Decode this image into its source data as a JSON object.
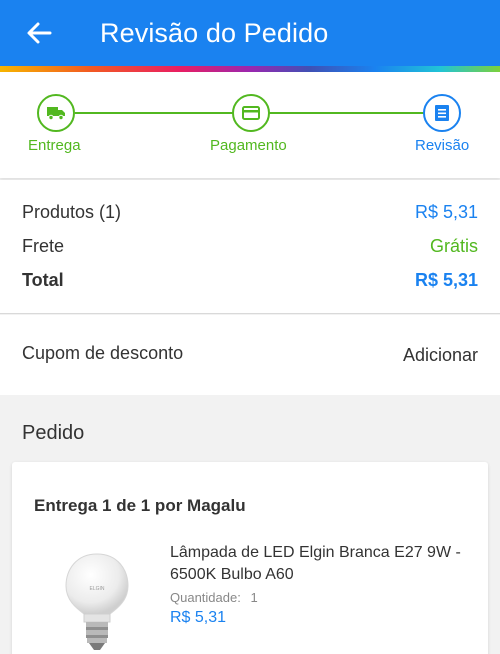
{
  "header": {
    "title": "Revisão do Pedido",
    "back_icon": "arrow-left-icon"
  },
  "stepper": {
    "steps": [
      {
        "label": "Entrega",
        "icon": "truck-icon",
        "state": "done"
      },
      {
        "label": "Pagamento",
        "icon": "credit-card-icon",
        "state": "done"
      },
      {
        "label": "Revisão",
        "icon": "document-list-icon",
        "state": "current"
      }
    ]
  },
  "summary": {
    "products_label": "Produtos (1)",
    "products_value": "R$ 5,31",
    "shipping_label": "Frete",
    "shipping_value": "Grátis",
    "total_label": "Total",
    "total_value": "R$ 5,31"
  },
  "coupon": {
    "label": "Cupom de desconto",
    "action": "Adicionar"
  },
  "order": {
    "section_title": "Pedido",
    "delivery_label": "Entrega 1 de 1 por Magalu",
    "product": {
      "name": "Lâmpada de LED Elgin Branca E27 9W - 6500K Bulbo A60",
      "quantity_label": "Quantidade:",
      "quantity": "1",
      "price": "R$ 5,31",
      "brand_on_image": "ELGIN"
    }
  },
  "colors": {
    "primary": "#1a82f0",
    "success": "#52b820"
  }
}
